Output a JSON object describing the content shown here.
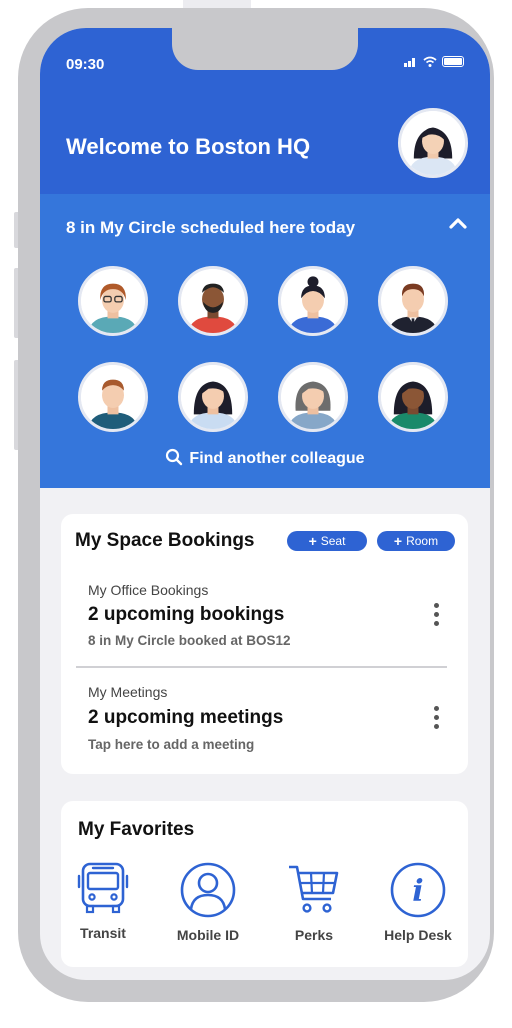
{
  "status": {
    "time": "09:30"
  },
  "header": {
    "title": "Welcome to Boston HQ"
  },
  "circle": {
    "title": "8 in My Circle scheduled here today",
    "find_label": "Find another colleague"
  },
  "bookings": {
    "title": "My Space Bookings",
    "seat_label": "Seat",
    "room_label": "Room",
    "office": {
      "label": "My Office Bookings",
      "value": "2 upcoming bookings",
      "sub": "8 in My Circle booked at BOS12"
    },
    "meetings": {
      "label": "My Meetings",
      "value": "2 upcoming meetings",
      "sub": "Tap here to add a meeting"
    }
  },
  "favorites": {
    "title": "My Favorites",
    "items": [
      {
        "label": "Transit",
        "icon": "bus-icon"
      },
      {
        "label": "Mobile ID",
        "icon": "person-icon"
      },
      {
        "label": "Perks",
        "icon": "cart-icon"
      },
      {
        "label": "Help Desk",
        "icon": "info-icon"
      }
    ]
  },
  "colors": {
    "brand_blue": "#2e63d3",
    "panel_blue": "#3576db",
    "frame": "#c8c8cb"
  }
}
